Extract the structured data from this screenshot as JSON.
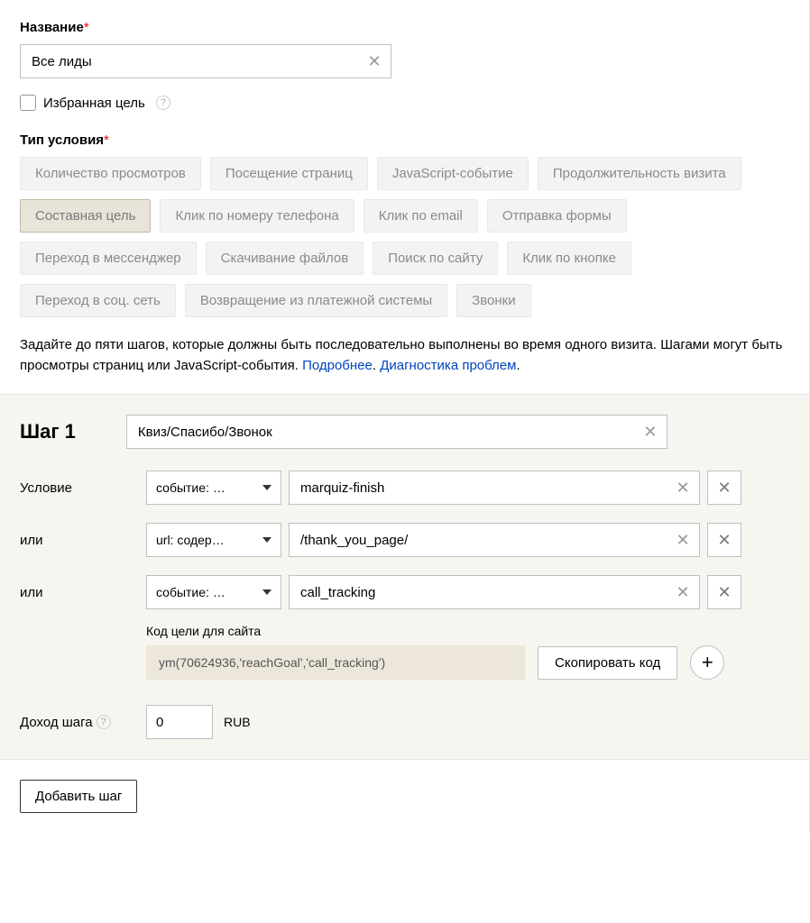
{
  "fields": {
    "name_label": "Название",
    "name_value": "Все лиды",
    "favorite_label": "Избранная цель",
    "condition_type_label": "Тип условия"
  },
  "condition_types": {
    "views": "Количество просмотров",
    "pages": "Посещение страниц",
    "js_event": "JavaScript-событие",
    "visit_duration": "Продолжительность визита",
    "composite": "Составная цель",
    "phone_click": "Клик по номеру телефона",
    "email_click": "Клик по email",
    "form_submit": "Отправка формы",
    "messenger": "Переход в мессенджер",
    "file_download": "Скачивание файлов",
    "site_search": "Поиск по сайту",
    "button_click": "Клик по кнопке",
    "social": "Переход в соц. сеть",
    "payment_return": "Возвращение из платежной системы",
    "calls": "Звонки"
  },
  "description": {
    "text": "Задайте до пяти шагов, которые должны быть последовательно выполнены во время одного визита. Шагами могут быть просмотры страниц или JavaScript-события. ",
    "link1": "Подробнее",
    "link2": "Диагностика проблем"
  },
  "step": {
    "title": "Шаг 1",
    "name_value": "Квиз/Спасибо/Звонок",
    "condition_label": "Условие",
    "or_label": "или",
    "conditions": [
      {
        "type": "событие: …",
        "value": "marquiz-finish"
      },
      {
        "type": "url: содер…",
        "value": "/thank_you_page/"
      },
      {
        "type": "событие: …",
        "value": "call_tracking"
      }
    ],
    "code_label": "Код цели для сайта",
    "code_value": "ym(70624936,'reachGoal','call_tracking')",
    "copy_button": "Скопировать код",
    "income_label": "Доход шага",
    "income_value": "0",
    "currency": "RUB"
  },
  "footer": {
    "add_step": "Добавить шаг"
  }
}
